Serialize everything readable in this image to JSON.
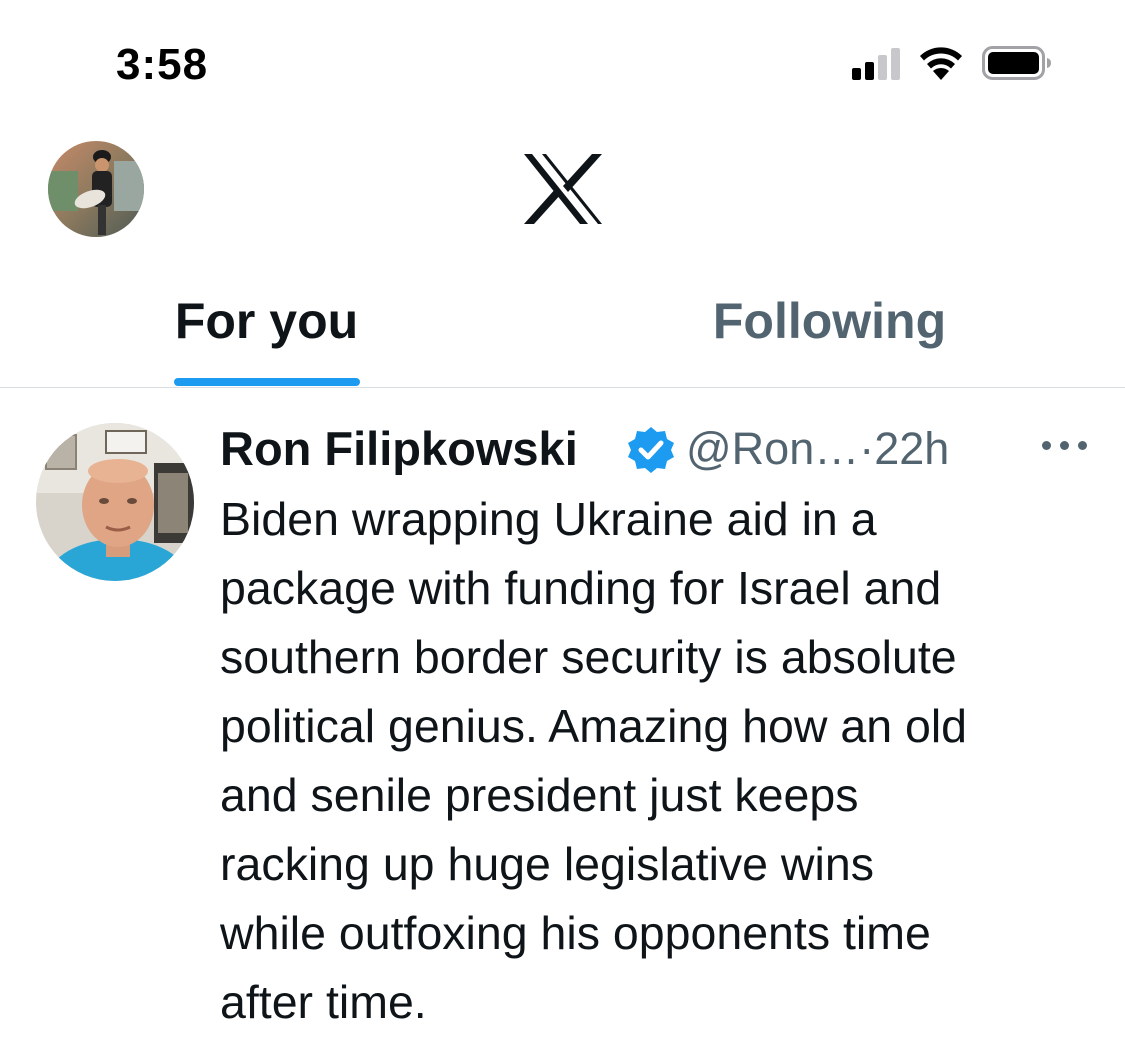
{
  "status_bar": {
    "time": "3:58",
    "icons": [
      "signal-icon",
      "wifi-icon",
      "battery-icon"
    ]
  },
  "header": {
    "profile_avatar": "profile-avatar",
    "logo": "x-logo-icon"
  },
  "tabs": [
    {
      "label": "For you",
      "active": true
    },
    {
      "label": "Following",
      "active": false
    }
  ],
  "colors": {
    "accent": "#1d9bf0",
    "text_primary": "#0f1419",
    "text_secondary": "#536471",
    "divider": "#d9dee2"
  },
  "tweet": {
    "author_name": "Ron Filipkowski",
    "verified": true,
    "handle": "@Ron…",
    "separator": "·",
    "time": "22h",
    "text": "Biden wrapping Ukraine aid in a\npackage with funding for Israel and\nsouthern border security is absolute\npolitical genius. Amazing how an old\nand senile president just keeps\nracking up huge legislative wins\nwhile outfoxing his opponents time\nafter time.",
    "more_icon": "more-options-icon"
  }
}
